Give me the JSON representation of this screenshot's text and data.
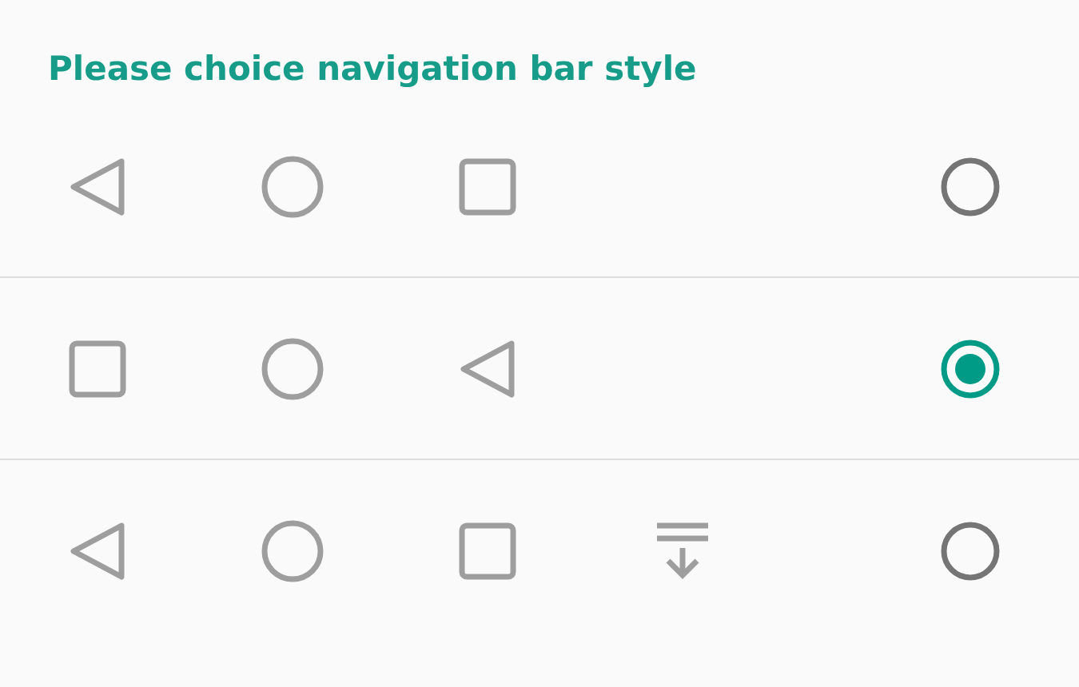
{
  "title": "Please choice navigation bar style",
  "options": [
    {
      "buttons": [
        {
          "kind": "back"
        },
        {
          "kind": "home"
        },
        {
          "kind": "recents"
        }
      ],
      "selected": false
    },
    {
      "buttons": [
        {
          "kind": "recents"
        },
        {
          "kind": "home"
        },
        {
          "kind": "back"
        }
      ],
      "selected": true
    },
    {
      "buttons": [
        {
          "kind": "back"
        },
        {
          "kind": "home"
        },
        {
          "kind": "recents"
        },
        {
          "kind": "hide"
        }
      ],
      "selected": false
    }
  ]
}
